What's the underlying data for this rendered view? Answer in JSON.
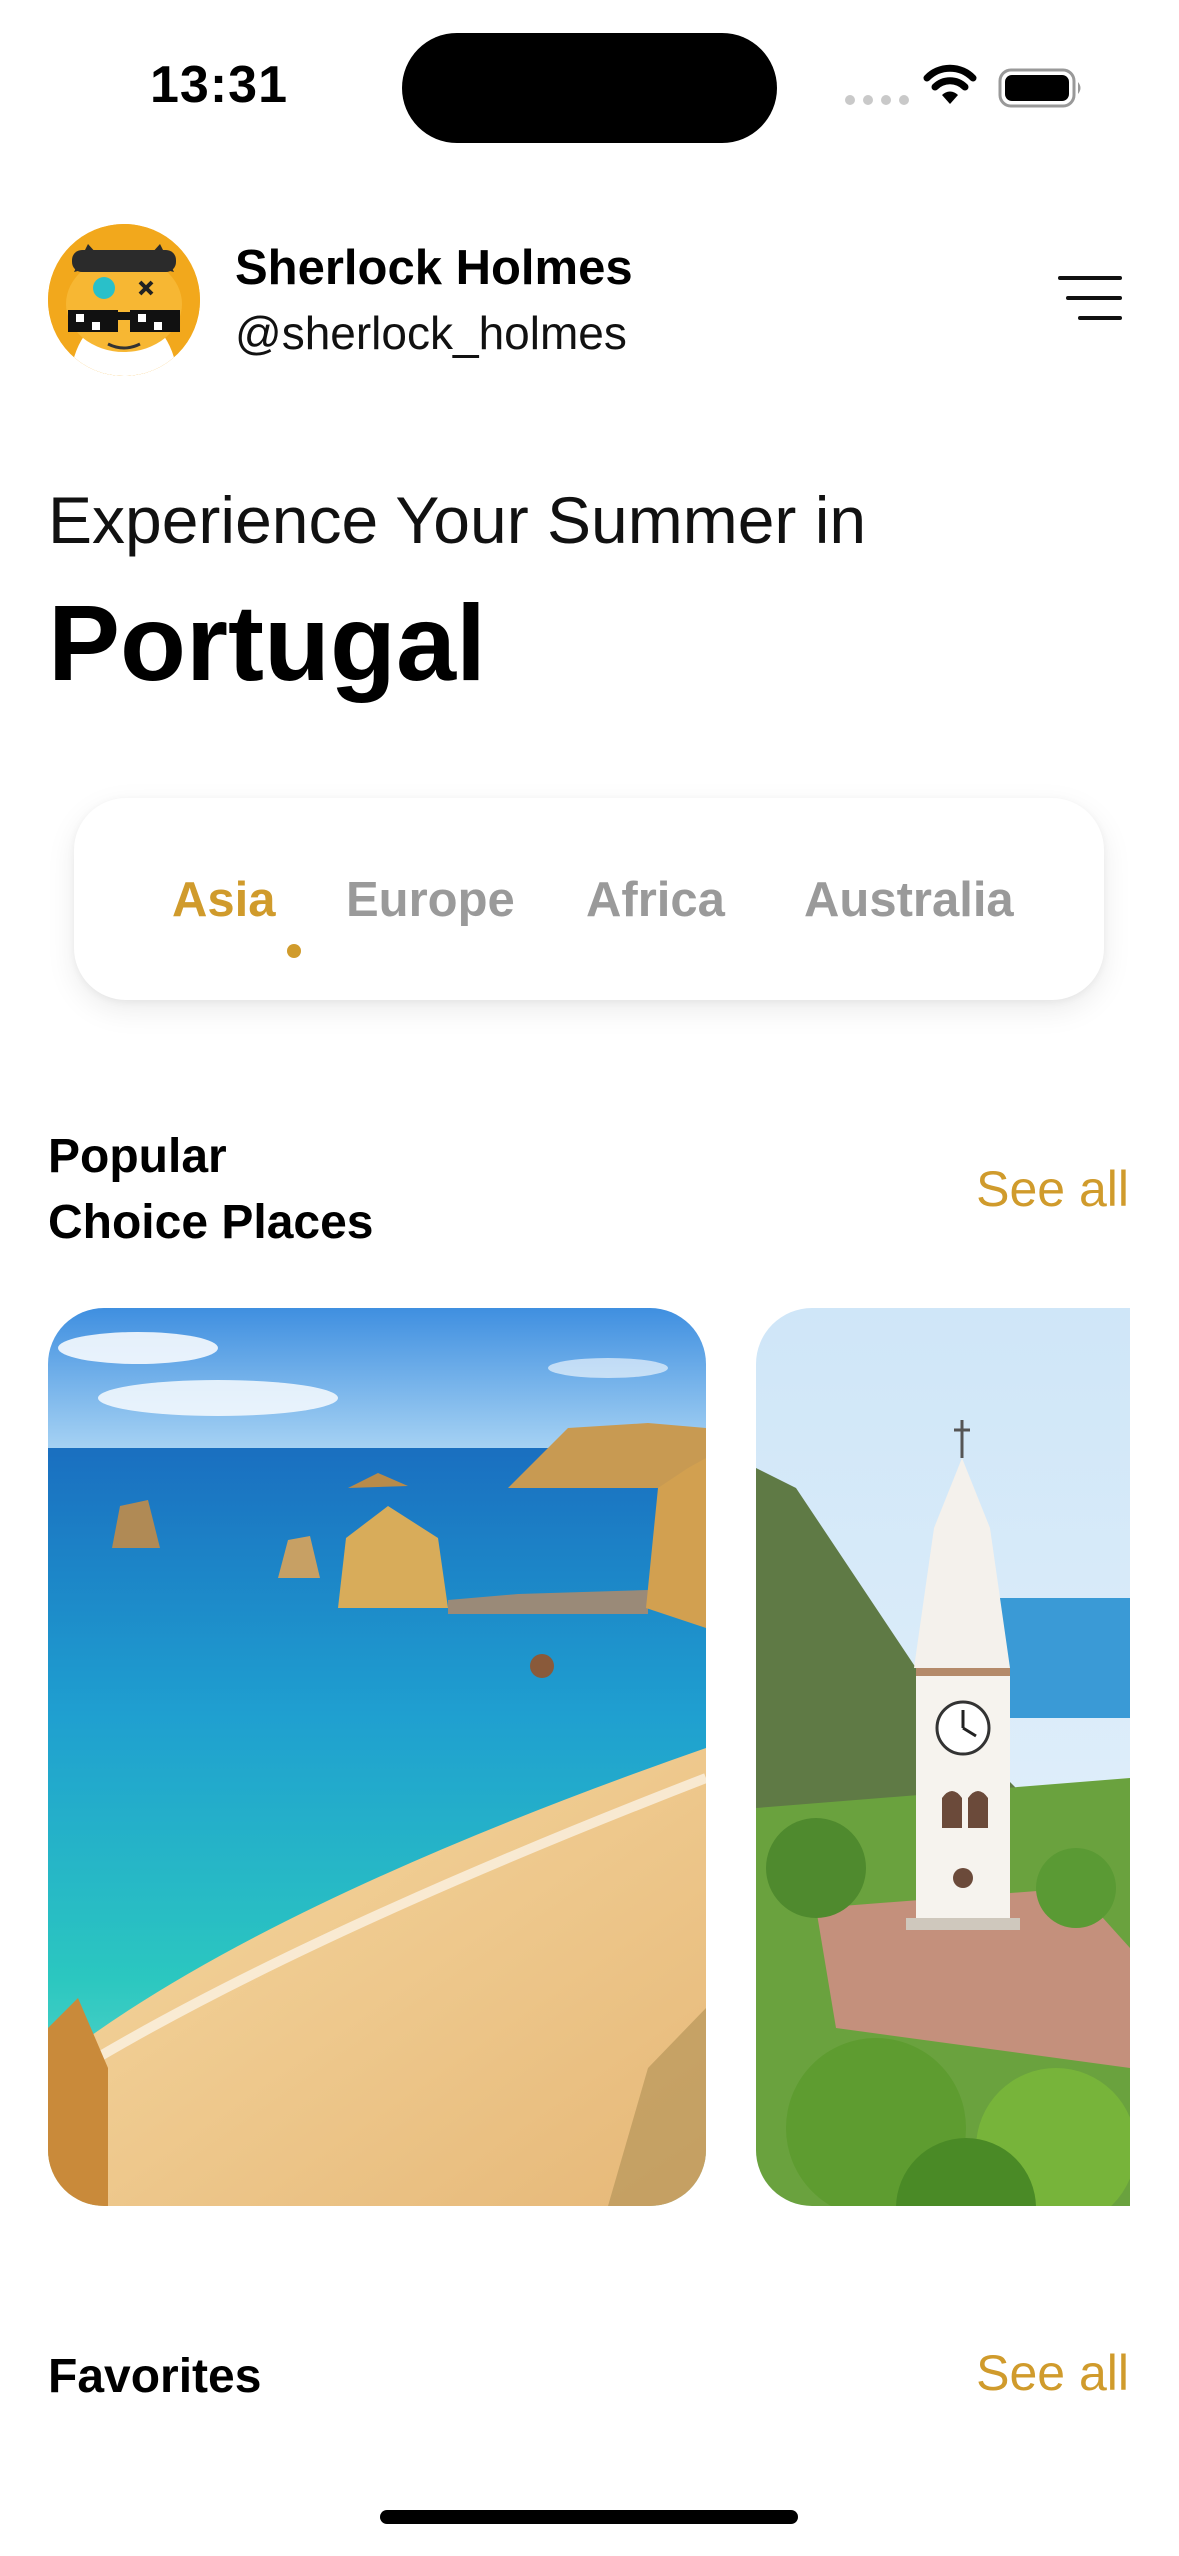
{
  "status_bar": {
    "time": "13:31"
  },
  "profile": {
    "name": "Sherlock Holmes",
    "handle": "@sherlock_holmes"
  },
  "headline": {
    "intro": "Experience Your Summer in",
    "country": "Portugal"
  },
  "tabs": [
    {
      "label": "Asia",
      "active": true
    },
    {
      "label": "Europe",
      "active": false
    },
    {
      "label": "Africa",
      "active": false
    },
    {
      "label": "Australia",
      "active": false
    }
  ],
  "popular": {
    "title_line1": "Popular",
    "title_line2": "Choice Places",
    "see_all": "See all",
    "places": [
      {
        "image": "beach-cove-photo"
      },
      {
        "image": "clock-tower-church-photo"
      }
    ]
  },
  "favorites": {
    "title": "Favorites",
    "see_all": "See all"
  },
  "colors": {
    "accent": "#d09b2c",
    "inactive_tab": "#9a9a9a",
    "text": "#000000"
  }
}
